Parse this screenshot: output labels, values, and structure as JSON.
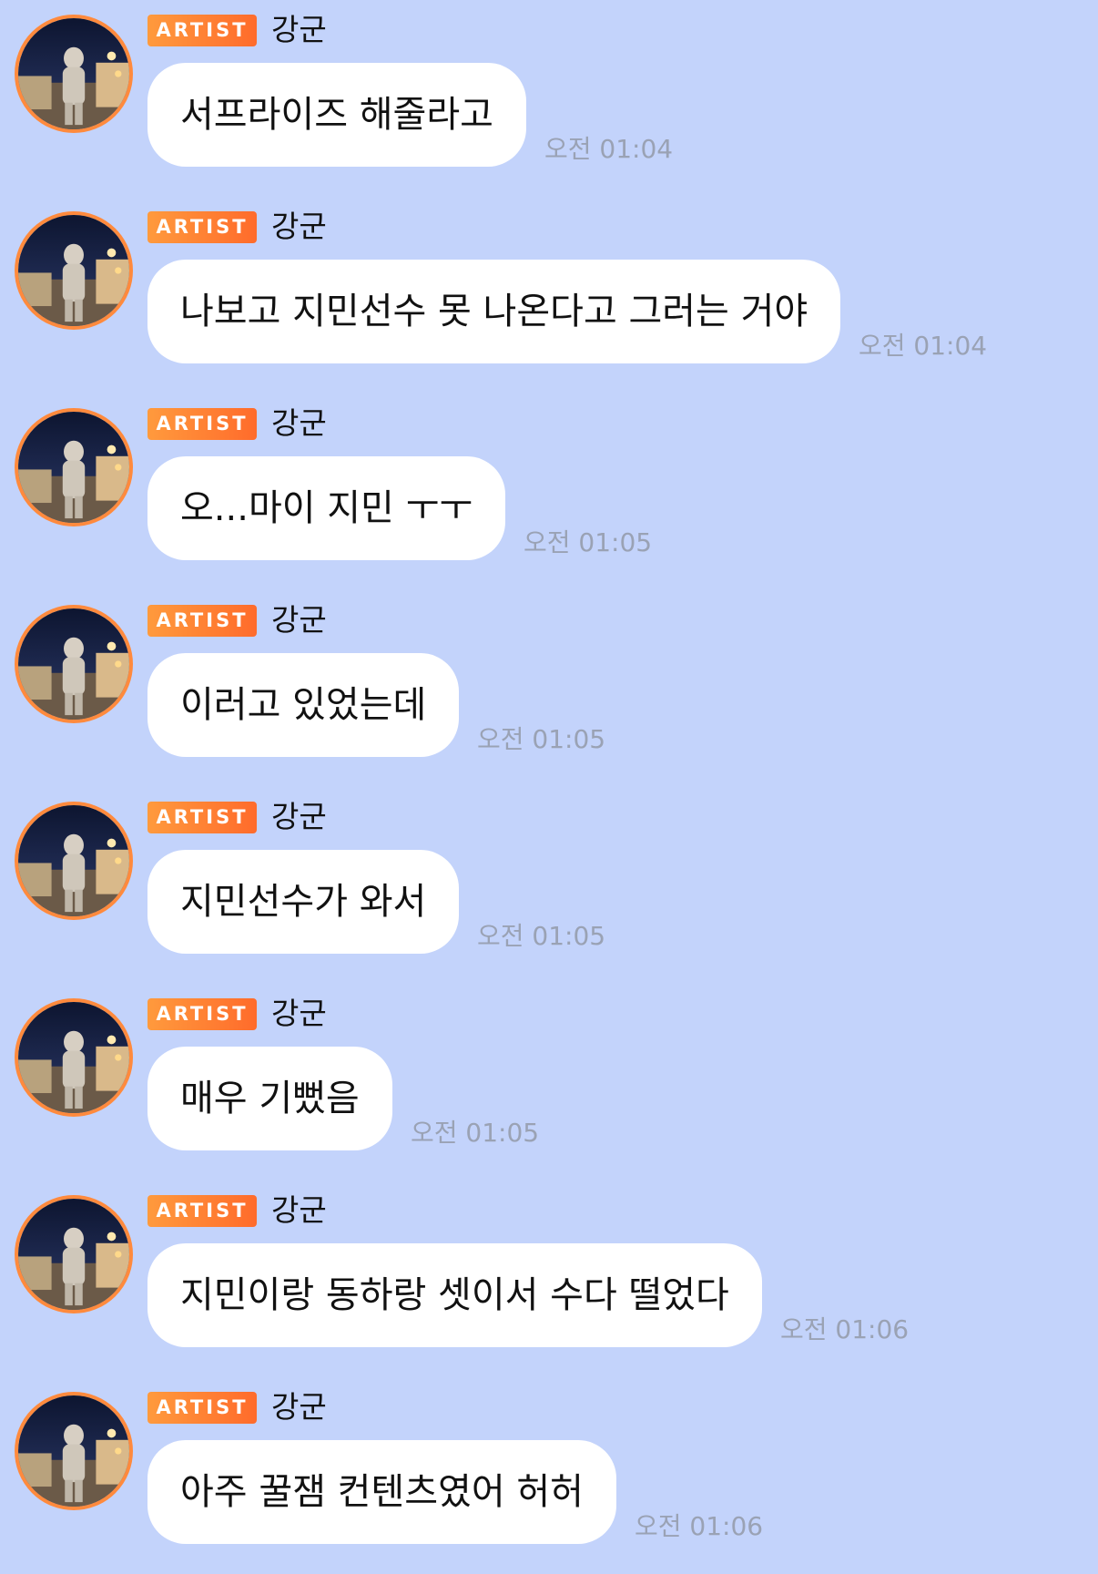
{
  "colors": {
    "background": "#c3d3fb",
    "bubble": "#ffffff",
    "badge_start": "#ff9a3d",
    "badge_end": "#ff6b2b",
    "avatar_ring": "#ff8a3d",
    "timestamp": "#9aa2b4"
  },
  "messages": [
    {
      "badge": "ARTIST",
      "sender": "강군",
      "avatar": "artist-avatar-icon",
      "text": "서프라이즈 해줄라고",
      "time": "오전 01:04"
    },
    {
      "badge": "ARTIST",
      "sender": "강군",
      "avatar": "artist-avatar-icon",
      "text": "나보고 지민선수 못 나온다고 그러는 거야",
      "time": "오전 01:04"
    },
    {
      "badge": "ARTIST",
      "sender": "강군",
      "avatar": "artist-avatar-icon",
      "text": "오...마이 지민 ㅜㅜ",
      "time": "오전 01:05"
    },
    {
      "badge": "ARTIST",
      "sender": "강군",
      "avatar": "artist-avatar-icon",
      "text": "이러고 있었는데",
      "time": "오전 01:05"
    },
    {
      "badge": "ARTIST",
      "sender": "강군",
      "avatar": "artist-avatar-icon",
      "text": "지민선수가 와서",
      "time": "오전 01:05"
    },
    {
      "badge": "ARTIST",
      "sender": "강군",
      "avatar": "artist-avatar-icon",
      "text": "매우 기뻤음",
      "time": "오전 01:05"
    },
    {
      "badge": "ARTIST",
      "sender": "강군",
      "avatar": "artist-avatar-icon",
      "text": "지민이랑 동하랑 셋이서 수다 떨었다",
      "time": "오전 01:06"
    },
    {
      "badge": "ARTIST",
      "sender": "강군",
      "avatar": "artist-avatar-icon",
      "text": "아주 꿀잼 컨텐츠였어 허허",
      "time": "오전 01:06"
    }
  ]
}
